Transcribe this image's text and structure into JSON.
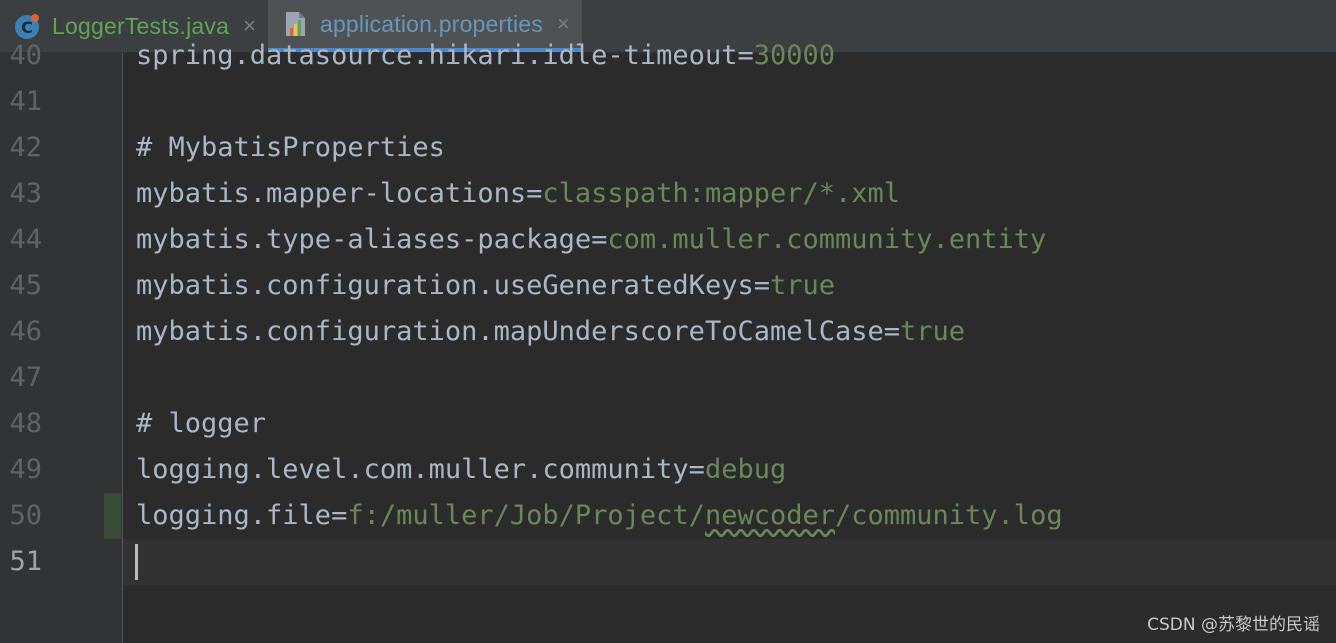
{
  "tabs": [
    {
      "label": "LoggerTests.java",
      "icon": "java-class-icon",
      "active": false,
      "close": "×"
    },
    {
      "label": "application.properties",
      "icon": "properties-file-icon",
      "active": true,
      "close": "×"
    }
  ],
  "editor": {
    "lines": [
      {
        "num": "40",
        "key": "spring.datasource.hikari.idle-timeout=",
        "value": "30000"
      },
      {
        "num": "41",
        "key": "",
        "value": ""
      },
      {
        "num": "42",
        "comment": "# MybatisProperties"
      },
      {
        "num": "43",
        "key": "mybatis.mapper-locations=",
        "value": "classpath:mapper/*.xml"
      },
      {
        "num": "44",
        "key": "mybatis.type-aliases-package=",
        "value": "com.muller.community.entity"
      },
      {
        "num": "45",
        "key": "mybatis.configuration.useGeneratedKeys=",
        "value": "true"
      },
      {
        "num": "46",
        "key": "mybatis.configuration.mapUnderscoreToCamelCase=",
        "value": "true"
      },
      {
        "num": "47",
        "key": "",
        "value": ""
      },
      {
        "num": "48",
        "comment": "# logger"
      },
      {
        "num": "49",
        "key": "logging.level.com.muller.community=",
        "value": "debug"
      },
      {
        "num": "50",
        "key": "logging.file=",
        "value_a": "f:/muller/Job/Project/",
        "value_typo": "newcoder",
        "value_b": "/community.log"
      },
      {
        "num": "51",
        "key": "",
        "value": ""
      }
    ]
  },
  "watermark": "CSDN @苏黎世的民谣",
  "colors": {
    "background": "#2b2b2b",
    "gutter": "#313335",
    "key": "#a9b7c6",
    "value": "#6a8759",
    "line_number": "#606366",
    "active_tab_underline": "#4a88c7"
  }
}
